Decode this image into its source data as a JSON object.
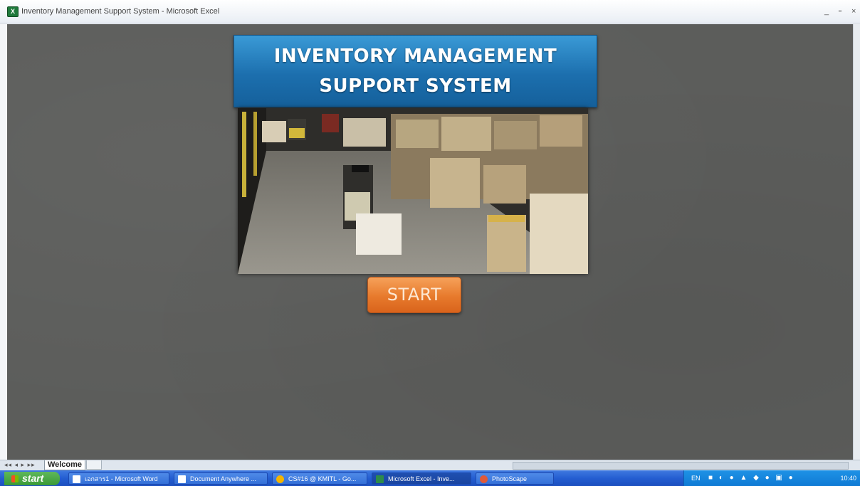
{
  "window": {
    "title": "Inventory Management Support System - Microsoft Excel",
    "controls": [
      "_",
      "▫",
      "×"
    ]
  },
  "banner": {
    "line1": "INVENTORY MANAGEMENT",
    "line2": "SUPPORT SYSTEM",
    "color": "#1c6fae"
  },
  "start_button": {
    "label": "START",
    "color": "#e77a2c"
  },
  "sheet_tabs": {
    "nav": "◂◂ ◂ ▸ ▸▸",
    "active": "Welcome"
  },
  "taskbar": {
    "start_label": "start",
    "tasks": [
      "เอกสาร1 - Microsoft Word",
      "Document Anywhere ...",
      "CS#16 @ KMITL - Go...",
      "Microsoft Excel - Inve...",
      "PhotoScape"
    ],
    "language": "EN",
    "time": "10:40"
  }
}
